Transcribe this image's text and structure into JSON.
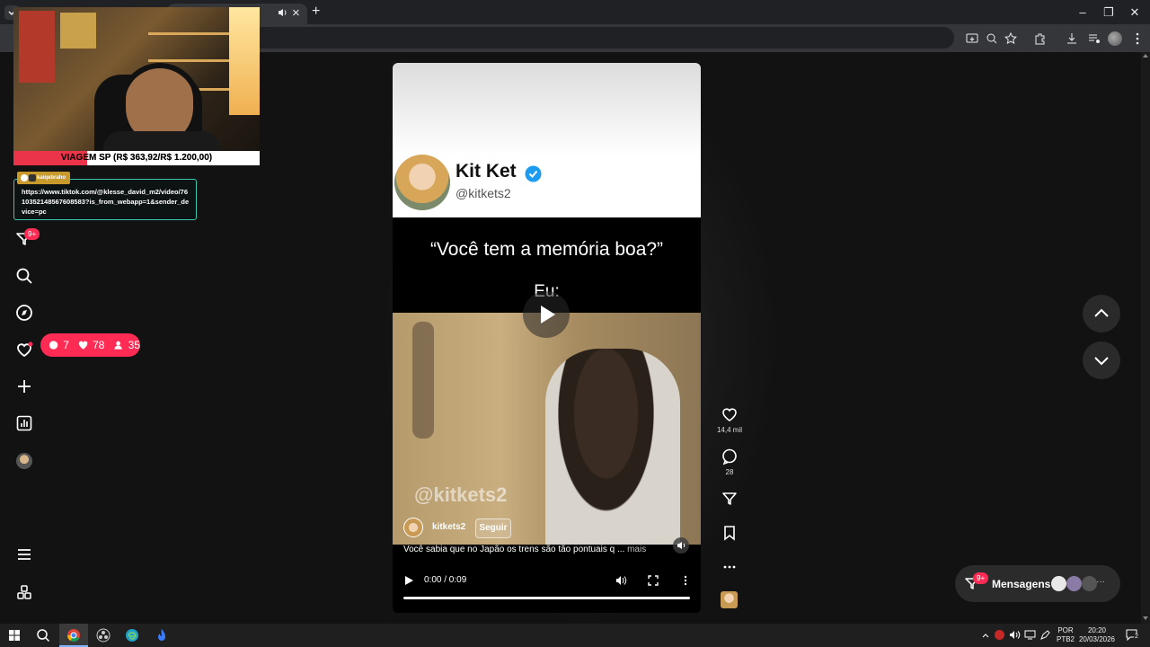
{
  "tab": {
    "audio_icon": "speaker-icon",
    "close_label": "×",
    "new_tab_label": "+"
  },
  "window": {
    "minimize": "–",
    "restore": "❐",
    "close": "✕"
  },
  "overlay": {
    "banner_text": "VIAGEM SP (R$ 363,92/R$ 1.200,00)",
    "banner_progress": 0.3,
    "tooltip_user": "kaiqebraho",
    "tooltip_text": "https://www.tiktok.com/@klesse_david_m2/video/7610352148567608583?is_from_webapp=1&sender_device=pc"
  },
  "nav": {
    "inbox_badge": "9+"
  },
  "stats": {
    "comments": "7",
    "likes": "78",
    "viewers": "35"
  },
  "video": {
    "tweet_name": "Kit Ket",
    "tweet_handle": "@kitkets2",
    "quote": "“Você tem a memória boa?”",
    "eu": "Eu:",
    "watermark": "@kitkets2",
    "author": "kitkets2",
    "follow_label": "Seguir",
    "caption": "Você sabia que no Japão os trens são tão pontuais q ...",
    "caption_more": "mais",
    "time": "0:00 / 0:09",
    "progress": 0
  },
  "actions": {
    "likes": "14,4 mil",
    "comments": "28"
  },
  "messages": {
    "label": "Mensagens",
    "badge": "9+"
  },
  "taskbar": {
    "lang_top": "POR",
    "lang_bottom": "PTB2",
    "time": "20:20",
    "date": "20/03/2026",
    "notif_count": "2"
  },
  "colors": {
    "accent": "#fe2c55",
    "verified": "#1d9bf0",
    "tooltip_border": "#3cc7b0"
  }
}
